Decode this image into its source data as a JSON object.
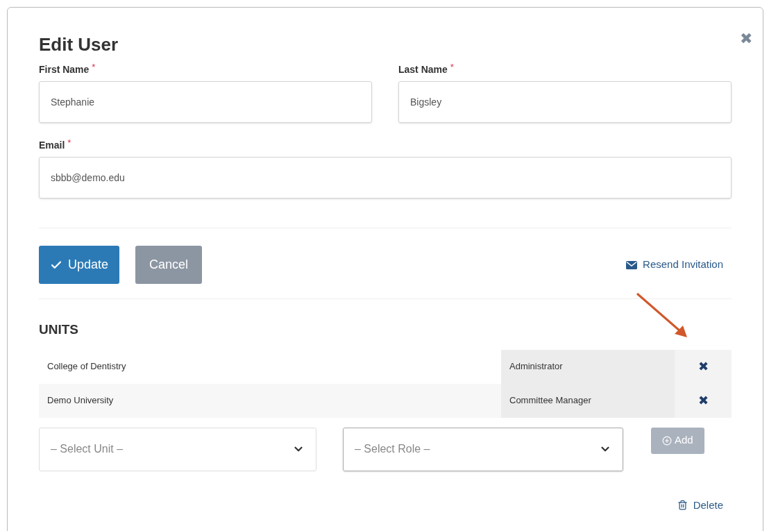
{
  "dialog": {
    "title": "Edit User",
    "close": "✖"
  },
  "fields": [
    {
      "label": "First Name",
      "required_mark": "*",
      "value": "Stephanie"
    },
    {
      "label": "Last Name",
      "required_mark": "*",
      "value": "Bigsley"
    },
    {
      "label": "Email",
      "required_mark": "*",
      "value": "sbbb@demo.edu"
    }
  ],
  "actions": {
    "update": "Update",
    "cancel": "Cancel",
    "resend": "Resend Invitation"
  },
  "units": {
    "heading": "UNITS",
    "rows": [
      {
        "unit": "College of Dentistry",
        "role": "Administrator",
        "remove": "✖"
      },
      {
        "unit": "Demo University",
        "role": "Committee Manager",
        "remove": "✖"
      }
    ],
    "unit_select": {
      "placeholder": "– Select Unit –"
    },
    "role_select": {
      "placeholder": "– Select Role –",
      "focused": true
    },
    "add": {
      "label": "Add",
      "disabled": true
    }
  },
  "delete": "Delete"
}
